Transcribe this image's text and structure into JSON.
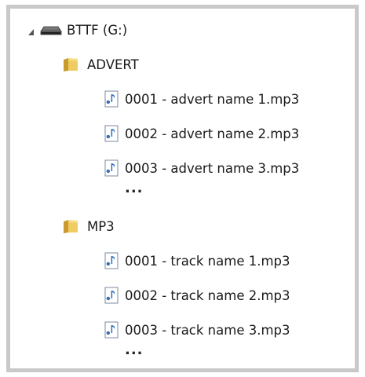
{
  "tree": {
    "drive": {
      "label": "BTTF (G:)",
      "icon": "drive-icon",
      "expanded": true,
      "folders": [
        {
          "label": "ADVERT",
          "icon": "folder-icon",
          "files": [
            {
              "label": "0001 - advert name 1.mp3",
              "icon": "audio-file-icon"
            },
            {
              "label": "0002 - advert name 2.mp3",
              "icon": "audio-file-icon"
            },
            {
              "label": "0003 - advert name 3.mp3",
              "icon": "audio-file-icon"
            }
          ],
          "more": "..."
        },
        {
          "label": "MP3",
          "icon": "folder-icon",
          "files": [
            {
              "label": "0001 - track name 1.mp3",
              "icon": "audio-file-icon"
            },
            {
              "label": "0002 - track name 2.mp3",
              "icon": "audio-file-icon"
            },
            {
              "label": "0003 - track name 3.mp3",
              "icon": "audio-file-icon"
            }
          ],
          "more": "..."
        }
      ]
    }
  },
  "colors": {
    "frame_border": "#c9c9c9",
    "folder_yellow": "#e8c14a",
    "audio_blue": "#2f6fb8",
    "text": "#1a1a1a"
  }
}
